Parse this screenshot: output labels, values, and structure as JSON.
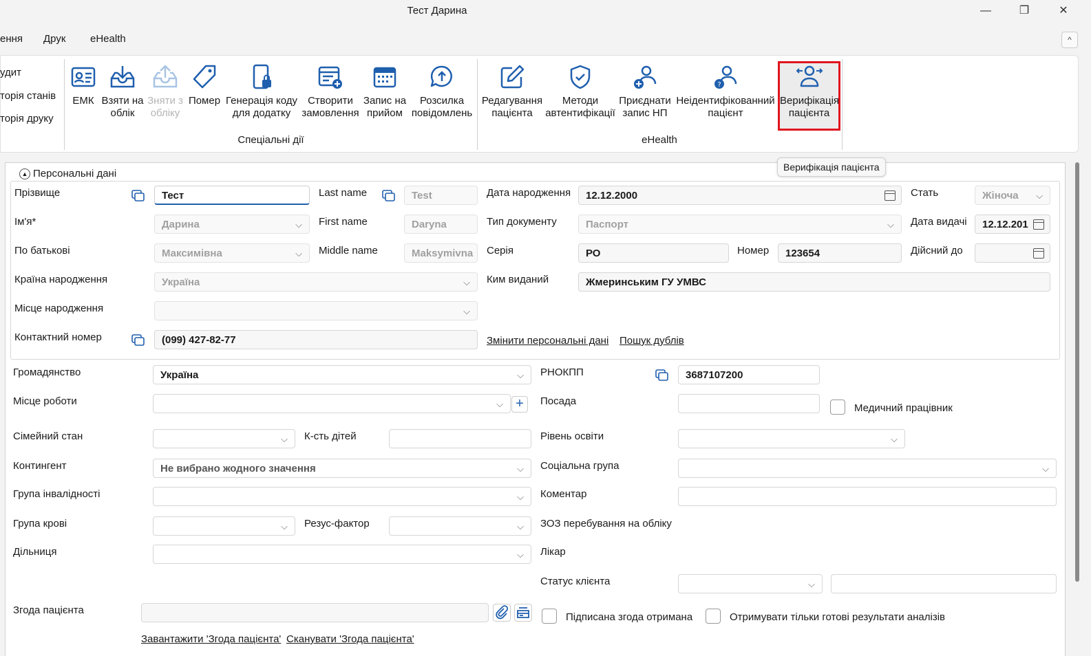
{
  "window": {
    "title": "Тест Дарина",
    "minimize": "—",
    "restore": "❐",
    "close": "✕"
  },
  "menu": {
    "items": [
      "ення",
      "Друк",
      "eHealth"
    ],
    "collapse": "^"
  },
  "left_links": [
    "удит",
    "торія станів",
    "торія друку"
  ],
  "ribbon": {
    "special": {
      "label": "Спеціальні дії",
      "buttons": [
        {
          "l1": "ЕМК",
          "l2": ""
        },
        {
          "l1": "Взяти на",
          "l2": "облік"
        },
        {
          "l1": "Зняти з",
          "l2": "обліку"
        },
        {
          "l1": "Помер",
          "l2": ""
        },
        {
          "l1": "Генерація коду",
          "l2": "для додатку"
        },
        {
          "l1": "Створити",
          "l2": "замовлення"
        },
        {
          "l1": "Запис на",
          "l2": "прийом"
        },
        {
          "l1": "Розсилка",
          "l2": "повідомлень"
        }
      ]
    },
    "ehealth": {
      "label": "eHealth",
      "buttons": [
        {
          "l1": "Редагування",
          "l2": "пацієнта"
        },
        {
          "l1": "Методи",
          "l2": "автентифікації"
        },
        {
          "l1": "Приєднати",
          "l2": "запис НП"
        },
        {
          "l1": "Неідентифікованний",
          "l2": "пацієнт"
        },
        {
          "l1": "Верифікація",
          "l2": "пацієнта"
        }
      ]
    },
    "tooltip": "Верифікація пацієнта"
  },
  "personal": {
    "legend": "Персональні дані",
    "surname": {
      "label": "Прізвище",
      "value": "Тест"
    },
    "name": {
      "label": "Ім'я*",
      "value": "Дарина"
    },
    "patronymic": {
      "label": "По батькові",
      "value": "Максимівна"
    },
    "birth_country": {
      "label": "Країна народження",
      "value": "Україна"
    },
    "birth_place": {
      "label": "Місце народження",
      "value": ""
    },
    "phone": {
      "label": "Контактний номер",
      "value": "(099) 427-82-77"
    },
    "last_name": {
      "label": "Last name",
      "value": "Test"
    },
    "first_name": {
      "label": "First name",
      "value": "Daryna"
    },
    "middle_name": {
      "label": "Middle name",
      "value": "Maksymivna"
    },
    "birth_date": {
      "label": "Дата народження",
      "value": "12.12.2000"
    },
    "doc_type": {
      "label": "Тип документу",
      "value": "Паспорт"
    },
    "series": {
      "label": "Серія",
      "value": "РО"
    },
    "number": {
      "label": "Номер",
      "value": "123654"
    },
    "issued_by": {
      "label": "Ким виданий",
      "value": "Жмеринським ГУ УМВС"
    },
    "sex": {
      "label": "Стать",
      "value": "Жіноча"
    },
    "issue_date": {
      "label": "Дата видачі",
      "value": "12.12.201"
    },
    "valid_to": {
      "label": "Дійсний до",
      "value": ""
    },
    "change_link": "Змінити персональні дані",
    "dup_link": "Пошук дублів"
  },
  "other": {
    "citizenship": {
      "label": "Громадянство",
      "value": "Україна"
    },
    "workplace": {
      "label": "Місце роботи",
      "value": ""
    },
    "marital": {
      "label": "Сімейний стан",
      "value": ""
    },
    "children": {
      "label": "К-сть дітей",
      "value": ""
    },
    "contingent": {
      "label": "Контингент",
      "value": "Не вибрано жодного значення"
    },
    "disability": {
      "label": "Група інвалідності",
      "value": ""
    },
    "blood": {
      "label": "Група крові",
      "value": ""
    },
    "rh": {
      "label": "Резус-фактор",
      "value": ""
    },
    "district": {
      "label": "Дільниця",
      "value": ""
    },
    "rnokpp": {
      "label": "РНОКПП",
      "value": "3687107200"
    },
    "position": {
      "label": "Посада",
      "value": ""
    },
    "medical_worker": "Медичний працівник",
    "education": {
      "label": "Рівень освіти",
      "value": ""
    },
    "social": {
      "label": "Соціальна група",
      "value": ""
    },
    "comment": {
      "label": "Коментар",
      "value": ""
    },
    "zoz": {
      "label": "ЗОЗ перебування на обліку"
    },
    "doctor": {
      "label": "Лікар"
    },
    "client_status": {
      "label": "Статус клієнта",
      "value": ""
    },
    "consent": {
      "label": "Згода пацієнта",
      "value": ""
    },
    "consent_signed": "Підписана згода отримана",
    "only_ready": "Отримувати тільки готові результати аналізів",
    "upload_link": "Завантажити 'Згода пацієнта'",
    "scan_link": "Сканувати 'Згода пацієнта'"
  }
}
